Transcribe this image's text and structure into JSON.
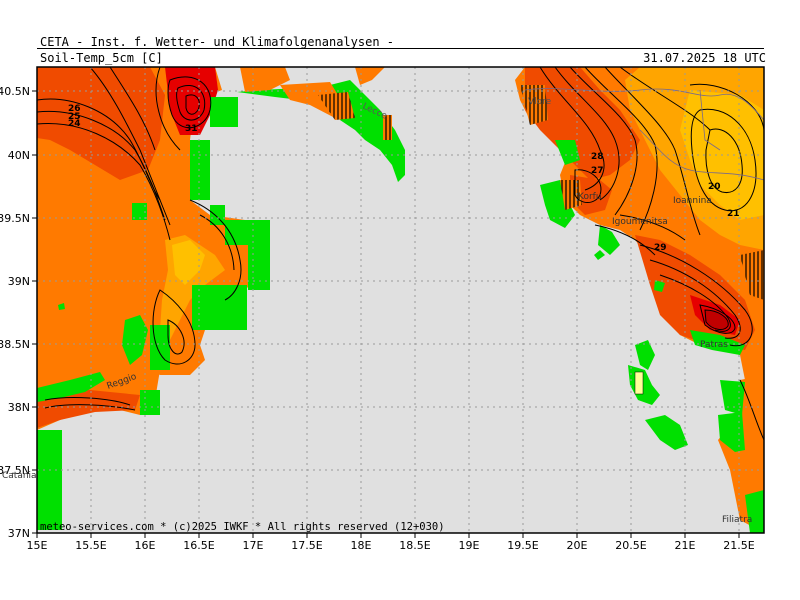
{
  "header": {
    "title": "CETA - Inst. f. Wetter- und Klimafolgenanalysen -",
    "parameter": "Soil-Temp_5cm [C]",
    "datetime": "31.07.2025 18 UTC"
  },
  "footer": {
    "copyright": "meteo-services.com * (c)2025 IWKF * All rights reserved (12+030)"
  },
  "axes": {
    "lat_ticks": [
      "40.5N",
      "40N",
      "39.5N",
      "39N",
      "38.5N",
      "38N",
      "37.5N",
      "37N"
    ],
    "lon_ticks": [
      "15E",
      "15.5E",
      "16E",
      "16.5E",
      "17E",
      "17.5E",
      "18E",
      "18.5E",
      "19E",
      "19.5E",
      "20E",
      "20.5E",
      "21E",
      "21.5E"
    ]
  },
  "places": {
    "lecce": "Lecce",
    "vlore": "Vlore",
    "korfu": "Korfu",
    "igoumenitsa": "Igoumenitsa",
    "ioannina": "Ioannina",
    "patras": "Patras",
    "filiatra": "Filiatra",
    "catania": "Catania",
    "reggio": "Reggio"
  },
  "contour_labels": {
    "c26": "26",
    "c27": "27",
    "c28": "28",
    "c29": "29",
    "c20": "20",
    "c21": "21",
    "c31": "31",
    "c25": "25",
    "c24": "24"
  },
  "colors": {
    "sea": "#e0e0e0",
    "land_green": "#00e000",
    "red": "#e60000",
    "dark_orange": "#f04b00",
    "orange": "#ff7a00",
    "amber": "#ffa500",
    "yellow_orange": "#ffc000"
  },
  "map_type": "soil-temperature contour map, lat 37N–40.75N, lon 15E–21.75E, dotted grid"
}
